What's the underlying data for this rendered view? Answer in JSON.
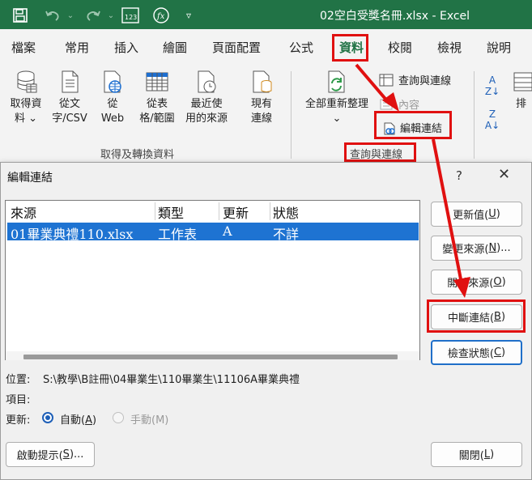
{
  "window": {
    "title": "02空白受獎名冊.xlsx  -  Excel"
  },
  "quick_access": {
    "icons": [
      "save-icon",
      "undo-icon",
      "redo-icon",
      "numeric-format-icon",
      "function-icon",
      "customize-dropdown-icon"
    ]
  },
  "ribbon_tabs": [
    {
      "label": "檔案"
    },
    {
      "label": "常用"
    },
    {
      "label": "插入"
    },
    {
      "label": "繪圖"
    },
    {
      "label": "頁面配置"
    },
    {
      "label": "公式"
    },
    {
      "label": "資料",
      "active": true
    },
    {
      "label": "校閱"
    },
    {
      "label": "檢視"
    },
    {
      "label": "說明"
    }
  ],
  "ribbon": {
    "get_transform": {
      "buttons": [
        {
          "line1": "取得資",
          "line2": "料 ⌄"
        },
        {
          "line1": "從文",
          "line2": "字/CSV"
        },
        {
          "line1": "從",
          "line2": "Web"
        },
        {
          "line1": "從表",
          "line2": "格/範圍"
        },
        {
          "line1": "最近使",
          "line2": "用的來源"
        },
        {
          "line1": "現有",
          "line2": "連線"
        }
      ],
      "group_label": "取得及轉換資料"
    },
    "queries_connections": {
      "refresh_all_label": "全部重新整理",
      "refresh_all_caret": "⌄",
      "queries_label": "查詢與連線",
      "properties_label": "內容",
      "edit_links_label": "編輯連結",
      "group_label": "查詢與連線"
    },
    "sort": {
      "sort_label": "排"
    }
  },
  "dialog": {
    "title": "編輯連結",
    "help": "?",
    "close": "✕",
    "columns": [
      "來源",
      "類型",
      "更新",
      "狀態"
    ],
    "rows": [
      {
        "source": "01畢業典禮110.xlsx",
        "type": "工作表",
        "update": "A",
        "status": "不詳"
      }
    ],
    "buttons": {
      "update_values": {
        "text": "更新值(",
        "key": "U",
        "end": ")"
      },
      "change_source": {
        "text": "變更來源(",
        "key": "N",
        "end": ")..."
      },
      "open_source": {
        "text": "開啟來源(",
        "key": "O",
        "end": ")"
      },
      "break_link": {
        "text": "中斷連結(",
        "key": "B",
        "end": ")"
      },
      "check_status": {
        "text": "檢查狀態(",
        "key": "C",
        "end": ")"
      }
    },
    "location_label": "位置:",
    "location_value": "S:\\教學\\B註冊\\04畢業生\\110畢業生\\11106A畢業典禮",
    "item_label": "項目:",
    "update_label": "更新:",
    "update_auto": {
      "text": "自動(",
      "key": "A",
      "end": ")",
      "selected": true
    },
    "update_manual": {
      "text": "手動(M)",
      "selected": false
    },
    "startup_prompt": {
      "text": "啟動提示(",
      "key": "S",
      "end": ")..."
    },
    "close_button": {
      "text": "關閉(",
      "key": "L",
      "end": ")"
    }
  },
  "colors": {
    "excel_green": "#217346",
    "highlight_red": "#e01010",
    "selection_blue": "#1e73d2"
  }
}
